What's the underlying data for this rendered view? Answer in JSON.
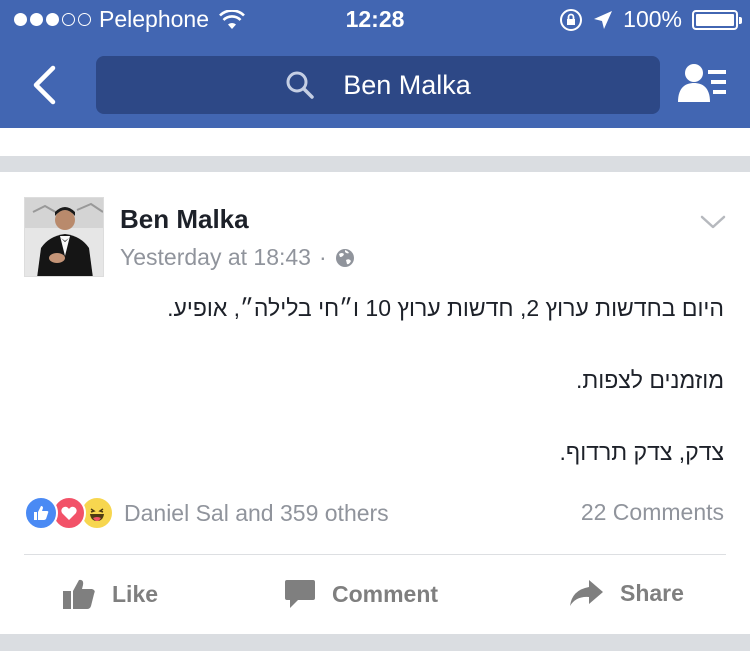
{
  "status_bar": {
    "carrier": "Pelephone",
    "time": "12:28",
    "battery": "100%",
    "signal_filled": 3,
    "signal_total": 5
  },
  "header": {
    "search_query": "Ben Malka",
    "bg_color": "#4266b2",
    "search_bg_color": "#2d4886"
  },
  "post": {
    "author": "Ben Malka",
    "timestamp": "Yesterday at 18:43",
    "separator": "·",
    "audience_icon": "globe-icon",
    "text_lines": [
      "היום בחדשות ערוץ 2, חדשות ערוץ 10 ו״חי בלילה״, אופיע.",
      "מוזמנים  לצפות.",
      "צדק, צדק תרדוף."
    ],
    "reactions": [
      "like",
      "love",
      "haha"
    ],
    "reactions_text": "Daniel Sal and 359 others",
    "comments_count": "22 Comments"
  },
  "actions": {
    "like": "Like",
    "comment": "Comment",
    "share": "Share"
  }
}
